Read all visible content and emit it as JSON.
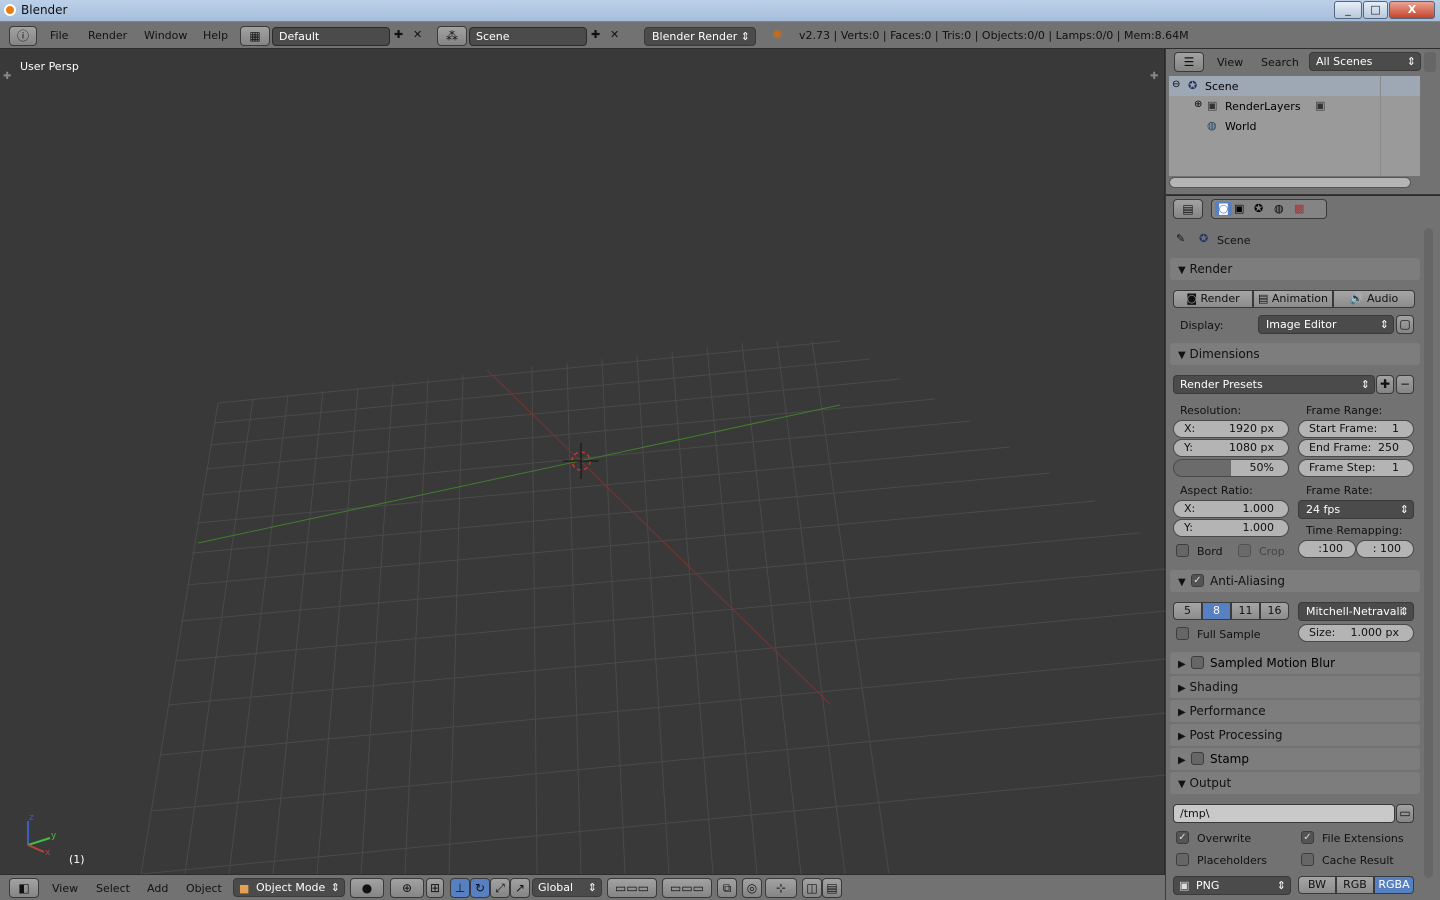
{
  "window": {
    "title": "Blender"
  },
  "infobar": {
    "menus": [
      "File",
      "Render",
      "Window",
      "Help"
    ],
    "screen_layout": "Default",
    "scene": "Scene",
    "engine": "Blender Render",
    "stats": "v2.73 | Verts:0 | Faces:0 | Tris:0 | Objects:0/0 | Lamps:0/0 | Mem:8.64M"
  },
  "viewport": {
    "view_name": "User Persp",
    "frame": "(1)",
    "axis_labels": {
      "x": "x",
      "y": "y",
      "z": "z"
    }
  },
  "viewport_header": {
    "menus": [
      "View",
      "Select",
      "Add",
      "Object"
    ],
    "mode": "Object Mode",
    "orientation": "Global"
  },
  "outliner": {
    "menus": [
      "View",
      "Search"
    ],
    "filter": "All Scenes",
    "items": [
      {
        "label": "Scene"
      },
      {
        "label": "RenderLayers"
      },
      {
        "label": "World"
      }
    ]
  },
  "properties": {
    "context": "Scene",
    "render": {
      "title": "Render",
      "buttons": [
        "Render",
        "Animation",
        "Audio"
      ],
      "display_label": "Display:",
      "display_value": "Image Editor"
    },
    "dimensions": {
      "title": "Dimensions",
      "presets": "Render Presets",
      "resolution_label": "Resolution:",
      "res_x": {
        "label": "X:",
        "value": "1920 px"
      },
      "res_y": {
        "label": "Y:",
        "value": "1080 px"
      },
      "res_pct": "50%",
      "frame_range_label": "Frame Range:",
      "start": {
        "label": "Start Frame:",
        "value": "1"
      },
      "end": {
        "label": "End Frame:",
        "value": "250"
      },
      "step": {
        "label": "Frame Step:",
        "value": "1"
      },
      "aspect_label": "Aspect Ratio:",
      "asp_x": {
        "label": "X:",
        "value": "1.000"
      },
      "asp_y": {
        "label": "Y:",
        "value": "1.000"
      },
      "frame_rate_label": "Frame Rate:",
      "frame_rate": "24 fps",
      "time_remap_label": "Time Remapping:",
      "remap_old": ":100",
      "remap_new": ": 100",
      "bord": "Bord",
      "crop": "Crop"
    },
    "anti_aliasing": {
      "title": "Anti-Aliasing",
      "samples": [
        "5",
        "8",
        "11",
        "16"
      ],
      "selected": "8",
      "filter": "Mitchell-Netravali",
      "full_sample": "Full Sample",
      "size": {
        "label": "Size:",
        "value": "1.000 px"
      }
    },
    "collapsed": [
      "Sampled Motion Blur",
      "Shading",
      "Performance",
      "Post Processing",
      "Stamp"
    ],
    "output": {
      "title": "Output",
      "path": "/tmp\\",
      "overwrite": "Overwrite",
      "file_ext": "File Extensions",
      "placeholders": "Placeholders",
      "cache": "Cache Result",
      "format": "PNG",
      "color_modes": [
        "BW",
        "RGB",
        "RGBA"
      ],
      "selected_color": "RGBA"
    }
  }
}
